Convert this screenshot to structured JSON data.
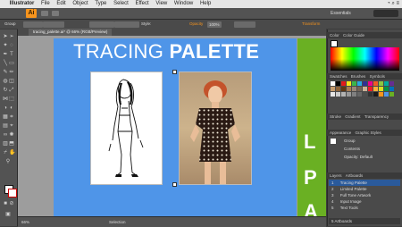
{
  "menubar": {
    "app": "Illustrator",
    "items": [
      "File",
      "Edit",
      "Object",
      "Type",
      "Select",
      "Effect",
      "View",
      "Window",
      "Help"
    ],
    "app_logo": "Ai"
  },
  "appbar": {
    "workspace": "Essentials"
  },
  "control": {
    "label": "Group",
    "style_label": "Style:",
    "opacity_label": "Opacity",
    "opacity_value": "100%",
    "right_label": "Transform"
  },
  "doc": {
    "tab_title": "tracing_palette.ai* @ 66% (RGB/Preview)"
  },
  "artboard": {
    "title_light": "TRACING",
    "title_bold": "PALETTE",
    "side_letters": [
      "L",
      "P",
      "A"
    ]
  },
  "status": {
    "zoom": "66%",
    "tool": "Selection"
  },
  "panels": {
    "color_tabs": [
      "Color",
      "Color Guide"
    ],
    "swatch_tabs": [
      "Swatches",
      "Brushes",
      "Symbols"
    ],
    "stroke_tabs": [
      "Stroke",
      "Gradient",
      "Transparency"
    ],
    "appearance_tabs": [
      "Appearance",
      "Graphic Styles"
    ],
    "appearance_items": [
      "Group",
      "Contents",
      "Opacity: Default"
    ],
    "layers_tabs": [
      "Layers",
      "Artboards"
    ],
    "artboards": [
      {
        "num": "1",
        "name": "Tracing Palette"
      },
      {
        "num": "2",
        "name": "Limited Palette"
      },
      {
        "num": "3",
        "name": "Full Tone Artwork"
      },
      {
        "num": "4",
        "name": "Input Image"
      },
      {
        "num": "5",
        "name": "Text Tools"
      }
    ],
    "artboards_footer": "5 Artboards"
  },
  "colors": {
    "accent": "#f7941d",
    "artboard_blue": "#4f95e8",
    "side_green": "#6ab023",
    "selection": "#2a5a9b"
  }
}
